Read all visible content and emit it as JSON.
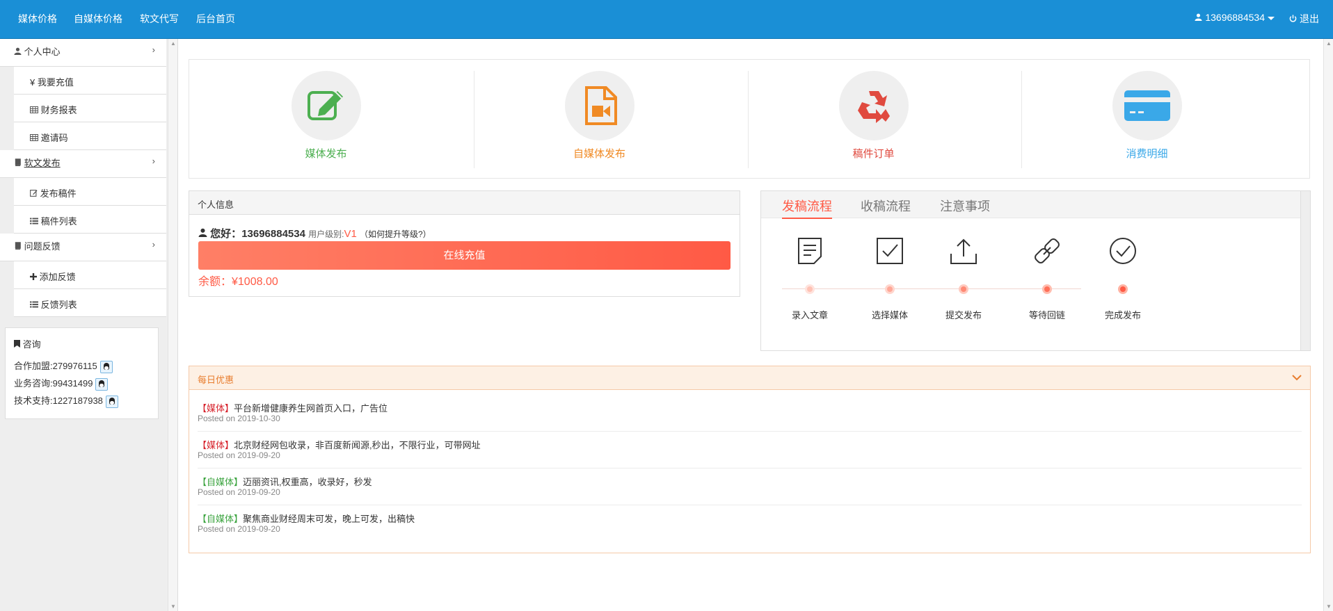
{
  "topbar": {
    "nav": [
      "媒体价格",
      "自媒体价格",
      "软文代写",
      "后台首页"
    ],
    "user": "13696884534",
    "logout": "退出",
    "colors": {
      "bar": "#1a8fd6"
    }
  },
  "sidebar": {
    "groups": [
      {
        "label": "个人中心",
        "icon": "user-icon",
        "items": [
          {
            "label": "我要充值",
            "icon": "yen-icon"
          },
          {
            "label": "财务报表",
            "icon": "table-icon"
          },
          {
            "label": "邀请码",
            "icon": "table-icon"
          }
        ]
      },
      {
        "label": "软文发布",
        "icon": "book-icon",
        "items": [
          {
            "label": "发布稿件",
            "icon": "edit-icon"
          },
          {
            "label": "稿件列表",
            "icon": "list-icon"
          }
        ]
      },
      {
        "label": "问题反馈",
        "icon": "book-icon",
        "items": [
          {
            "label": "添加反馈",
            "icon": "plus-icon"
          },
          {
            "label": "反馈列表",
            "icon": "list-icon"
          }
        ]
      }
    ],
    "consult": {
      "title": "咨询",
      "rows": [
        "合作加盟:279976115",
        "业务咨询:99431499",
        "技术支持:1227187938"
      ]
    }
  },
  "quick": [
    {
      "label": "媒体发布",
      "color": "#4caf50",
      "icon": "edit-icon"
    },
    {
      "label": "自媒体发布",
      "color": "#f08a24",
      "icon": "video-file-icon"
    },
    {
      "label": "稿件订单",
      "color": "#e04a3f",
      "icon": "recycle-icon"
    },
    {
      "label": "消费明细",
      "color": "#3aa8e8",
      "icon": "credit-card-icon"
    }
  ],
  "info": {
    "header": "个人信息",
    "greeting": "您好：",
    "phone": "13696884534",
    "level_label": "用户级别:",
    "level": "V1",
    "upgrade": "（如何提升等级?）",
    "recharge_button": "在线充值",
    "balance": "余额：¥1008.00"
  },
  "flow": {
    "tabs": [
      "发稿流程",
      "收稿流程",
      "注意事项"
    ],
    "active_tab": 0,
    "steps": [
      {
        "label": "录入文章",
        "icon": "document-icon"
      },
      {
        "label": "选择媒体",
        "icon": "checkbox-icon"
      },
      {
        "label": "提交发布",
        "icon": "upload-icon"
      },
      {
        "label": "等待回链",
        "icon": "link-icon"
      },
      {
        "label": "完成发布",
        "icon": "check-circle-icon"
      }
    ]
  },
  "daily": {
    "title": "每日优惠",
    "items": [
      {
        "tag": "【媒体】",
        "type": "media",
        "text": "平台新增健康养生网首页入口，广告位",
        "date": "Posted on 2019-10-30"
      },
      {
        "tag": "【媒体】",
        "type": "media",
        "text": "北京财经网包收录，非百度新闻源,秒出，不限行业，可带网址",
        "date": "Posted on 2019-09-20"
      },
      {
        "tag": "【自媒体】",
        "type": "self",
        "text": "迈丽资讯,权重高，收录好，秒发",
        "date": "Posted on 2019-09-20"
      },
      {
        "tag": "【自媒体】",
        "type": "self",
        "text": "聚焦商业财经周末可发，晚上可发，出稿快",
        "date": "Posted on 2019-09-20"
      }
    ]
  }
}
